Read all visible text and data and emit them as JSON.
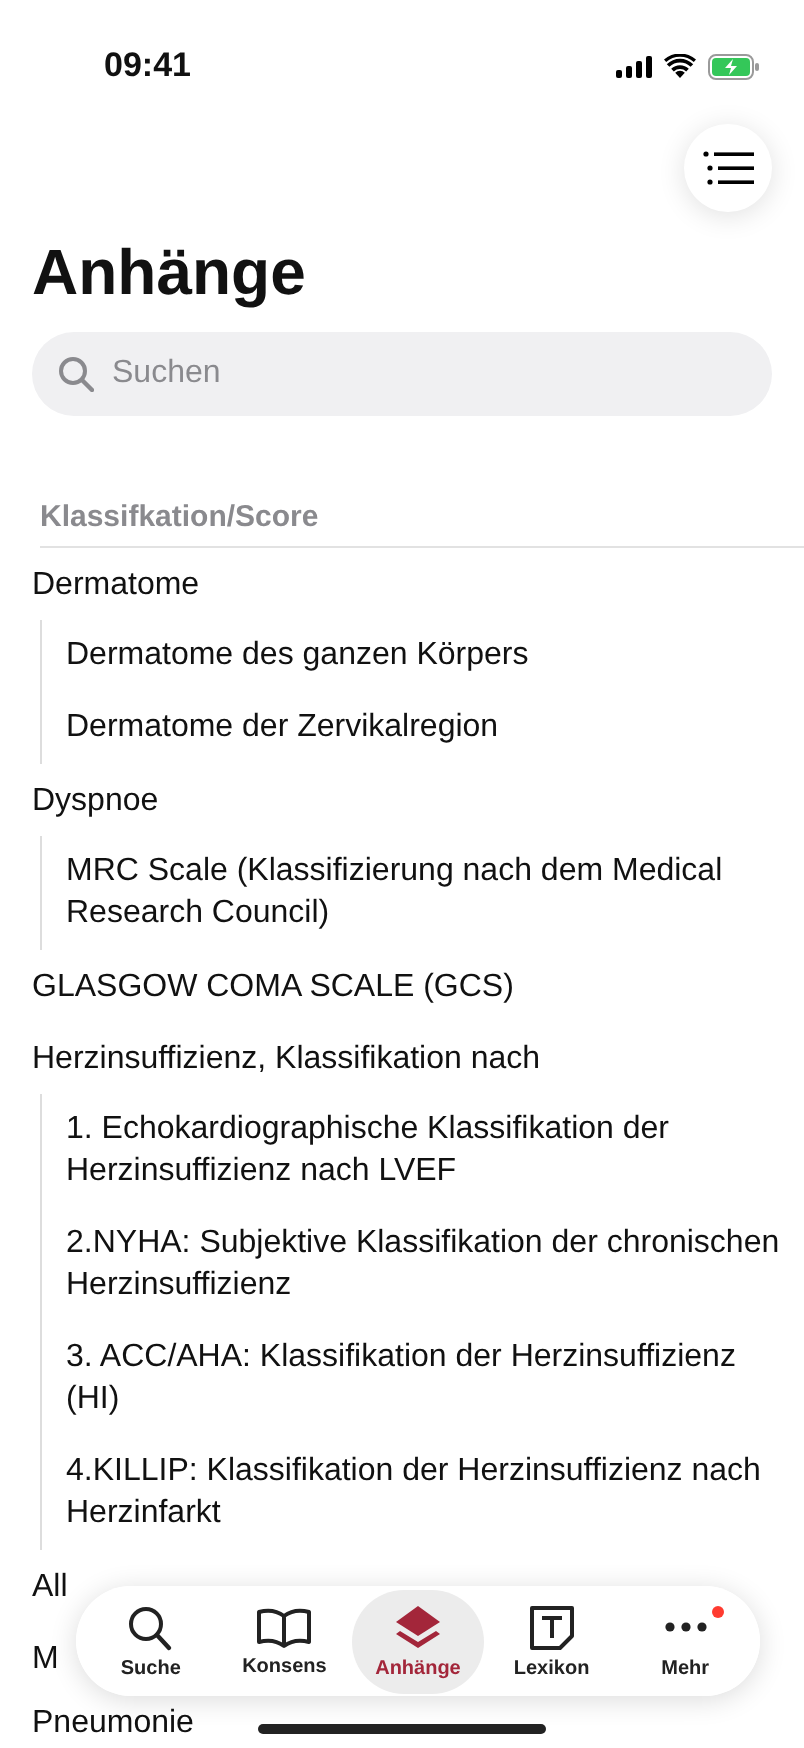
{
  "status_bar": {
    "time": "09:41"
  },
  "title": "Anhänge",
  "search": {
    "placeholder": "Suchen"
  },
  "section": "Klassifkation/Score",
  "groups": [
    {
      "title": "Dermatome",
      "items": [
        "Dermatome des ganzen Körpers",
        "Dermatome der Zervikalregion"
      ]
    },
    {
      "title": "Dyspnoe",
      "items": [
        "MRC Scale (Klassifizierung nach dem Medical Research Council)"
      ]
    },
    {
      "title": "GLASGOW COMA SCALE (GCS)"
    },
    {
      "title": "Herzinsuffizienz, Klassifikation nach",
      "items": [
        "1. Echokardiographische Klassifikation der Herzinsuffizienz nach LVEF",
        "2.NYHA: Subjektive Klassifikation der chronischen Herzinsuffizienz",
        "3. ACC/AHA: Klassifikation der Herzinsuffizienz (HI)",
        "4.KILLIP: Klassifikation der Herzinsuffizienz nach Herzinfarkt"
      ]
    },
    {
      "title": "All"
    },
    {
      "title": "M"
    },
    {
      "title": "Pneumonie"
    }
  ],
  "tabs": [
    {
      "label": "Suche",
      "kind": "search",
      "selected": false,
      "badge": false
    },
    {
      "label": "Konsens",
      "kind": "book",
      "selected": false,
      "badge": false
    },
    {
      "label": "Anhänge",
      "kind": "layers",
      "selected": true,
      "badge": false
    },
    {
      "label": "Lexikon",
      "kind": "lexicon",
      "selected": false,
      "badge": false
    },
    {
      "label": "Mehr",
      "kind": "more",
      "selected": false,
      "badge": true
    }
  ]
}
